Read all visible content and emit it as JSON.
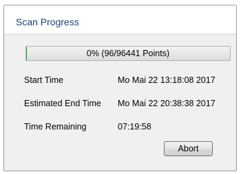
{
  "window": {
    "title": "Scan Progress"
  },
  "progress": {
    "text": "0% (96/96441 Points)",
    "fraction": 0.001
  },
  "info": {
    "rows": [
      {
        "label": "Start Time",
        "value": "Mo Mai 22 13:18:08 2017"
      },
      {
        "label": "Estimated End Time",
        "value": "Mo Mai 22 20:38:38 2017"
      },
      {
        "label": "Time Remaining",
        "value": "07:19:58"
      }
    ]
  },
  "buttons": {
    "abort_label": "Abort"
  },
  "colors": {
    "title_text": "#1e3f75",
    "progress_fill": "#06b025"
  }
}
